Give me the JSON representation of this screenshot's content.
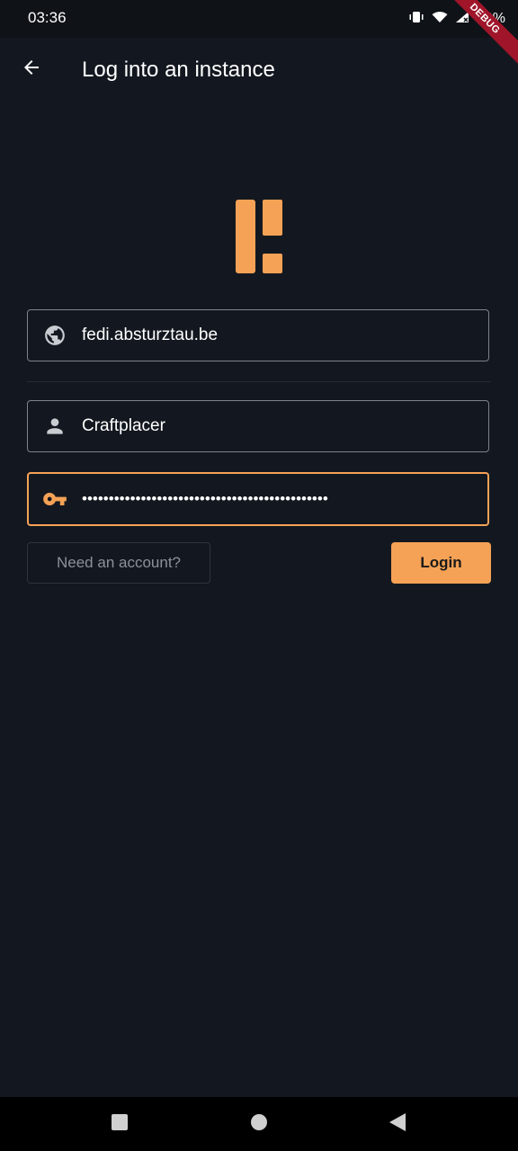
{
  "status_bar": {
    "time": "03:36",
    "battery": "40%",
    "debug_banner": "DEBUG",
    "icons": [
      "vibrate-icon",
      "wifi-icon",
      "signal-icon"
    ]
  },
  "app_bar": {
    "back_icon": "arrow-left-icon",
    "title": "Log into an instance"
  },
  "logo": {
    "name": "app-logo",
    "color": "#f5a256"
  },
  "form": {
    "instance": {
      "icon": "globe-icon",
      "value": "fedi.absturztau.be"
    },
    "username": {
      "icon": "person-icon",
      "value": "Craftplacer"
    },
    "password": {
      "icon": "key-icon",
      "value": "••••••••••••••••••••••••••••••••••••••••••••••"
    }
  },
  "actions": {
    "register_label": "Need an account?",
    "login_label": "Login"
  },
  "colors": {
    "background": "#131820",
    "accent": "#f5a256",
    "field_border": "#7d838c"
  },
  "nav_bar": {
    "icons": [
      "recents-square-icon",
      "home-circle-icon",
      "back-triangle-icon"
    ]
  }
}
